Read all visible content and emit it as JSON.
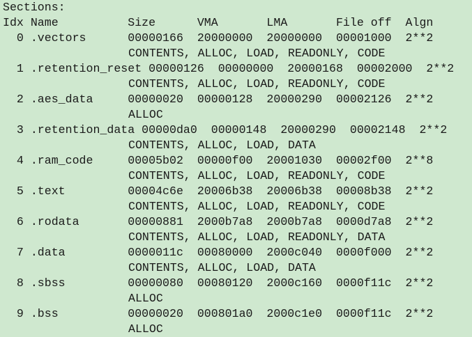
{
  "heading": "Sections:",
  "columns_line": "Idx Name          Size      VMA       LMA       File off  Algn",
  "sections": [
    {
      "idx": "0",
      "name": ".vectors",
      "line": "  0 .vectors      00000166  20000000  20000000  00001000  2**2",
      "flags": "CONTENTS, ALLOC, LOAD, READONLY, CODE"
    },
    {
      "idx": "1",
      "name": ".retention_reset",
      "line": "  1 .retention_reset 00000126  00000000  20000168  00002000  2**2",
      "flags": "CONTENTS, ALLOC, LOAD, READONLY, CODE"
    },
    {
      "idx": "2",
      "name": ".aes_data",
      "line": "  2 .aes_data     00000020  00000128  20000290  00002126  2**2",
      "flags": "ALLOC"
    },
    {
      "idx": "3",
      "name": ".retention_data",
      "line": "  3 .retention_data 00000da0  00000148  20000290  00002148  2**2",
      "flags": "CONTENTS, ALLOC, LOAD, DATA"
    },
    {
      "idx": "4",
      "name": ".ram_code",
      "line": "  4 .ram_code     00005b02  00000f00  20001030  00002f00  2**8",
      "flags": "CONTENTS, ALLOC, LOAD, READONLY, CODE"
    },
    {
      "idx": "5",
      "name": ".text",
      "line": "  5 .text         00004c6e  20006b38  20006b38  00008b38  2**2",
      "flags": "CONTENTS, ALLOC, LOAD, READONLY, CODE"
    },
    {
      "idx": "6",
      "name": ".rodata",
      "line": "  6 .rodata       00000881  2000b7a8  2000b7a8  0000d7a8  2**2",
      "flags": "CONTENTS, ALLOC, LOAD, READONLY, DATA"
    },
    {
      "idx": "7",
      "name": ".data",
      "line": "  7 .data         0000011c  00080000  2000c040  0000f000  2**2",
      "flags": "CONTENTS, ALLOC, LOAD, DATA"
    },
    {
      "idx": "8",
      "name": ".sbss",
      "line": "  8 .sbss         00000080  00080120  2000c160  0000f11c  2**2",
      "flags": "ALLOC"
    },
    {
      "idx": "9",
      "name": ".bss",
      "line": "  9 .bss          00000020  000801a0  2000c1e0  0000f11c  2**2",
      "flags": "ALLOC"
    }
  ]
}
